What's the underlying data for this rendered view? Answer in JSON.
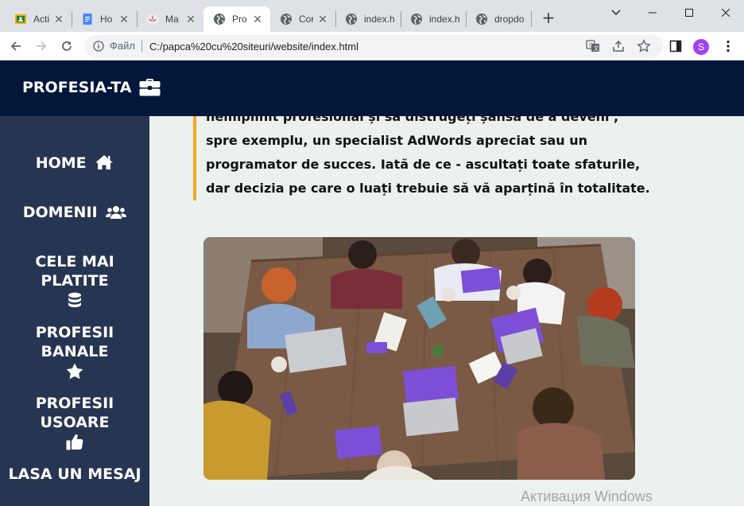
{
  "browser": {
    "tabs": [
      {
        "title": "Acti",
        "icon": "classroom-icon",
        "active": false
      },
      {
        "title": "Ho",
        "icon": "docs-icon",
        "active": false
      },
      {
        "title": "Ma",
        "icon": "lotus-icon",
        "active": false
      },
      {
        "title": "Pro",
        "icon": "globe-icon",
        "active": true
      },
      {
        "title": "Cor",
        "icon": "globe-icon",
        "active": false
      },
      {
        "title": "index.ht",
        "icon": "globe-icon",
        "active": false
      },
      {
        "title": "index.ht",
        "icon": "globe-icon",
        "active": false
      },
      {
        "title": "dropdo",
        "icon": "globe-icon",
        "active": false
      }
    ],
    "address": {
      "label": "Файл",
      "url": "C:/papca%20cu%20siteuri/website/index.html"
    },
    "profile_initial": "S",
    "profile_color": "#a142f4"
  },
  "site": {
    "brand": "PROFESIA-TA",
    "brand_icon": "briefcase-icon",
    "header_color": "#03173b",
    "sidebar_color": "#263552",
    "accent_color": "#f5a623",
    "nav": [
      {
        "label": "HOME",
        "icon": "home-icon"
      },
      {
        "label": "DOMENII",
        "icon": "users-icon"
      },
      {
        "label": "CELE MAI PLATITE",
        "icon": "database-icon"
      },
      {
        "label": "PROFESII BANALE",
        "icon": "star-icon"
      },
      {
        "label": "PROFESII USOARE",
        "icon": "thumbs-up-icon"
      },
      {
        "label": "LASA UN MESAJ",
        "icon": ""
      }
    ],
    "quote": "neîmplinit profesional și să distrugeți șansa de a deveni , spre exemplu, un specialist AdWords apreciat sau un programator de succes. Iată de ce - ascultați toate sfaturile, dar decizia pe care o luați trebuie să vă aparțină în totalitate."
  },
  "os": {
    "watermark": "Активация Windows"
  }
}
